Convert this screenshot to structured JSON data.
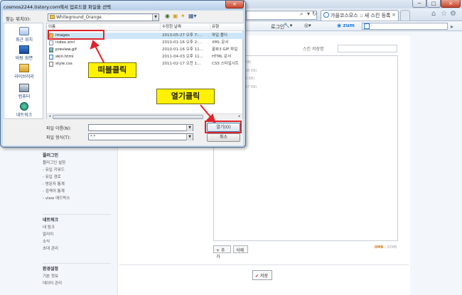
{
  "browser": {
    "tab_title": "가을코스모스 :: 새 스킨 등록",
    "tab_close": "×",
    "window_min": "─",
    "window_max": "□",
    "window_close": "×",
    "login_link": "로그인",
    "zum_logo": "zum",
    "search_placeholder": "-",
    "nav_icons": {
      "search": "⌕",
      "dropdown": "▾",
      "refresh": "↻"
    },
    "tool_icons": {
      "home": "⌂",
      "favorites": "☆",
      "settings": "⚙"
    }
  },
  "dialog": {
    "title": "cosmos2244.tistory.com에서 업로드할 파일을 선택",
    "close": "×",
    "lookin_label": "찾는 위치(I):",
    "lookin_value": "Whiteground_Orange",
    "places": [
      {
        "label": "최근 위치"
      },
      {
        "label": "바탕 화면"
      },
      {
        "label": "라이브러리"
      },
      {
        "label": "컴퓨터"
      },
      {
        "label": "네트워크"
      }
    ],
    "columns": {
      "name": "이름",
      "date": "수정한 날짜",
      "type": "유형"
    },
    "files": [
      {
        "name": "images",
        "date": "2013-05-27 오후 7:...",
        "type": "파일 폴더",
        "icon": "folder"
      },
      {
        "name": "index.xml",
        "date": "2010-01-16 오후 2:...",
        "type": "XML 문서",
        "icon": "doc"
      },
      {
        "name": "preview.gif",
        "date": "2010-01-16 오후 11...",
        "type": "꿀뷰3 GIF 파일",
        "icon": "img"
      },
      {
        "name": "skin.html",
        "date": "2011-04-03 오후 11...",
        "type": "HTML 문서",
        "icon": "html"
      },
      {
        "name": "style.css",
        "date": "2011-02-17 오전 1...",
        "type": "CSS 스타일시트",
        "icon": "css"
      }
    ],
    "filename_label": "파일 이름(N):",
    "filetype_label": "파일 형식(T):",
    "filetype_value": "*.*",
    "open_button": "열기(O)",
    "cancel_button": "취소"
  },
  "annotations": {
    "double_click": "떠블클릭",
    "open_click": "열기클릭",
    "color": "#e0242b",
    "label_bg": "#fff200"
  },
  "page": {
    "skin_save_label": "스킨 저장명",
    "size_lines": [
      "(KB)",
      "(08 KB)",
      "(6 KB)",
      "(67 KB)"
    ],
    "add_button": "+ 추가",
    "delete_button": "삭제",
    "storage_used": "0MB",
    "storage_total": " / 20MB",
    "save_check": "✔",
    "save_button": "저장",
    "sidebar": [
      {
        "heading": "플러그인",
        "items": [
          "플러그인 설정",
          "- 유입 키워드",
          "- 유입 경로",
          "- 방문자 통계",
          "- 검색어 통계",
          "- view 애드박스"
        ]
      },
      {
        "heading": "네트워크",
        "items": [
          "내 링크",
          "알리미",
          "소식",
          "초대 관리"
        ]
      },
      {
        "heading": "환경설정",
        "items": [
          "기본 정보",
          "데이터 관리"
        ]
      }
    ]
  }
}
